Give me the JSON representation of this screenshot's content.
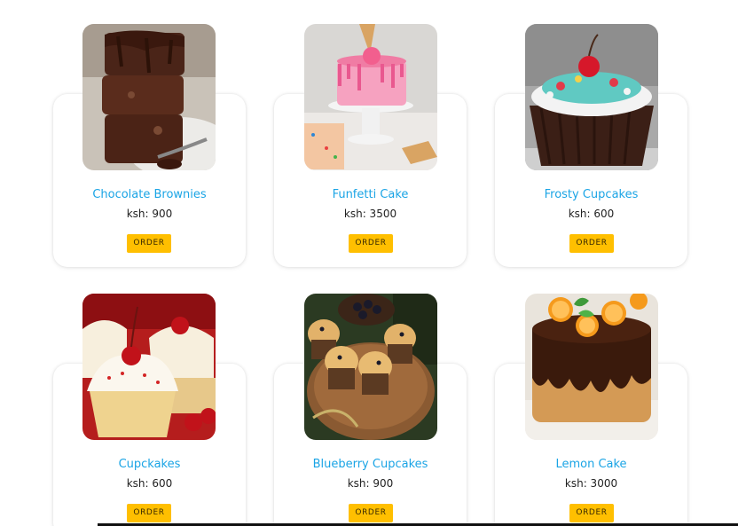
{
  "products": [
    {
      "name": "Chocolate Brownies",
      "price": "ksh: 900",
      "button": "ORDER",
      "image": "brownies-image"
    },
    {
      "name": "Funfetti Cake",
      "price": "ksh: 3500",
      "button": "ORDER",
      "image": "funfetti-cake-image"
    },
    {
      "name": "Frosty Cupcakes",
      "price": "ksh: 600",
      "button": "ORDER",
      "image": "frosty-cupcakes-image"
    },
    {
      "name": "Cupckakes",
      "price": "ksh: 600",
      "button": "ORDER",
      "image": "cupcakes-image"
    },
    {
      "name": "Blueberry Cupcakes",
      "price": "ksh: 900",
      "button": "ORDER",
      "image": "blueberry-cupcakes-image"
    },
    {
      "name": "Lemon Cake",
      "price": "ksh: 3000",
      "button": "ORDER",
      "image": "lemon-cake-image"
    }
  ],
  "colors": {
    "title": "#1aa4e5",
    "button": "#ffbf00",
    "background": "#ffffff"
  }
}
